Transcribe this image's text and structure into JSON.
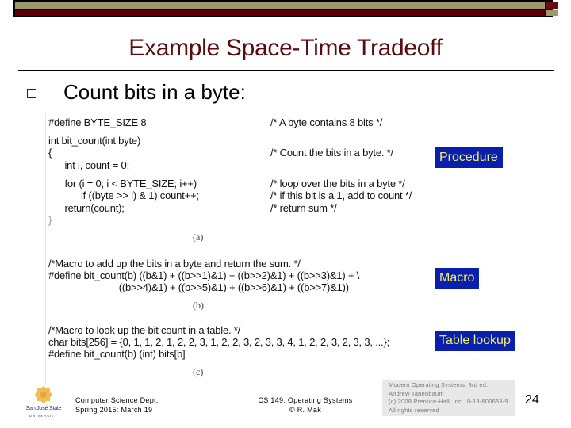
{
  "header": {
    "colors": {
      "olive": "#9c9a6a",
      "maroon": "#5c0006"
    }
  },
  "slide": {
    "title": "Example Space-Time Tradeoff",
    "bullet": "Count bits in a byte:"
  },
  "figure": {
    "procedure": {
      "code_lines": [
        "#define BYTE_SIZE 8",
        "int bit_count(int byte)",
        "{",
        "      int i, count = 0;",
        "      for (i = 0; i < BYTE_SIZE; i++)",
        "            if ((byte >> i) & 1) count++;",
        "      return(count);",
        "}"
      ],
      "comments": [
        "/* A byte contains 8 bits */",
        "/* Count the bits in a byte. */",
        "/* loop over the bits in a byte */",
        "/* if this bit is a 1, add to count */",
        "/* return sum */"
      ],
      "caption": "(a)",
      "tag": "Procedure"
    },
    "macro": {
      "code_lines": [
        "/*Macro to add up the bits in a byte and return the sum. */",
        "#define bit_count(b) ((b&1) + ((b>>1)&1) + ((b>>2)&1) + ((b>>3)&1) + \\",
        "                          ((b>>4)&1) + ((b>>5)&1) + ((b>>6)&1) + ((b>>7)&1))"
      ],
      "caption": "(b)",
      "tag": "Macro"
    },
    "table": {
      "code_lines": [
        "/*Macro to look up the bit count in a table. */",
        "char bits[256] = {0, 1, 1, 2, 1, 2, 2, 3, 1, 2, 2, 3, 2, 3, 3, 4, 1, 2, 2, 3, 2, 3, 3, ...};",
        "#define bit_count(b) (int) bits[b]"
      ],
      "caption": "(c)",
      "tag": "Table lookup"
    },
    "tag_colors": {
      "background": "#0a1fae",
      "text": "#f1f36a"
    }
  },
  "footer": {
    "logo": {
      "line1": "San José State",
      "line2": "UNIVERSITY"
    },
    "left": [
      "Computer Science Dept.",
      "Spring 2015: March 19"
    ],
    "middle": [
      "CS 149: Operating Systems",
      "© R. Mak"
    ],
    "reference": [
      "Modern Operating Systems, 3rd ed.",
      "Andrew Tanenbaum",
      "(c) 2008 Prentice-Hall, Inc.. 0-13-600663-9",
      "All rights reserved"
    ],
    "page_number": "24"
  }
}
